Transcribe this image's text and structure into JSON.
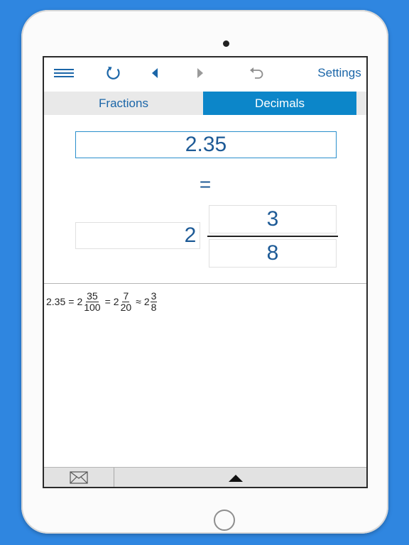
{
  "toolbar": {
    "menu_icon": "hamburger-icon",
    "reset_icon": "refresh-icon",
    "back_icon": "triangle-left-icon",
    "forward_icon": "triangle-right-icon",
    "undo_icon": "undo-icon",
    "settings_label": "Settings"
  },
  "tabs": [
    {
      "label": "Fractions",
      "active": false
    },
    {
      "label": "Decimals",
      "active": true
    }
  ],
  "converter": {
    "decimal_value": "2.35",
    "equals_sign": "=",
    "whole": "2",
    "numerator": "3",
    "denominator": "8"
  },
  "result": {
    "decimal": "2.35",
    "eq1": "=",
    "step1_whole": "2",
    "step1_num": "35",
    "step1_den": "100",
    "eq2": "=",
    "step2_whole": "2",
    "step2_num": "7",
    "step2_den": "20",
    "approx": "≈",
    "step3_whole": "2",
    "step3_num": "3",
    "step3_den": "8"
  },
  "bottom_bar": {
    "mail_icon": "envelope-icon",
    "expand_icon": "triangle-up-icon"
  },
  "colors": {
    "background": "#2f86e0",
    "accent": "#0c86c9",
    "text_blue": "#1d5a96"
  }
}
